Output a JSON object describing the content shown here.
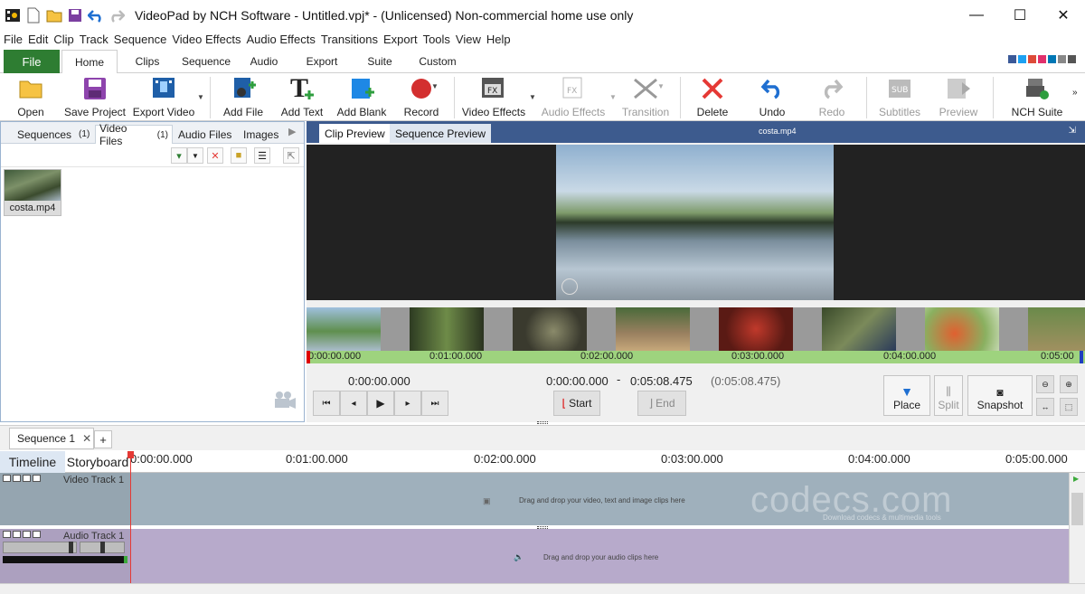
{
  "window": {
    "title": "VideoPad by NCH Software - Untitled.vpj* - (Unlicensed) Non-commercial home use only",
    "minimize": "—",
    "maximize": "☐",
    "close": "✕"
  },
  "menu": [
    "File",
    "Edit",
    "Clip",
    "Track",
    "Sequence",
    "Video Effects",
    "Audio Effects",
    "Transitions",
    "Export",
    "Tools",
    "View",
    "Help"
  ],
  "ribbon_tabs": {
    "file": "File",
    "tabs": [
      "Home",
      "Clips",
      "Sequence",
      "Audio",
      "Export",
      "Suite",
      "Custom"
    ],
    "active": "Home"
  },
  "ribbon": {
    "open": "Open",
    "save_project": "Save Project",
    "export_video": "Export Video",
    "add_file": "Add File",
    "add_text": "Add Text",
    "add_blank": "Add Blank",
    "record": "Record",
    "video_effects": "Video Effects",
    "audio_effects": "Audio Effects",
    "transition": "Transition",
    "delete": "Delete",
    "undo": "Undo",
    "redo": "Redo",
    "subtitles": "Subtitles",
    "preview": "Preview",
    "nch_suite": "NCH Suite",
    "text_glyph": "T",
    "sub_glyph": "SUB",
    "fx_glyph": "FX"
  },
  "left_panel": {
    "tabs": [
      {
        "label": "Sequences",
        "count": "(1)"
      },
      {
        "label": "Video Files",
        "count": "(1)"
      },
      {
        "label": "Audio Files",
        "count": ""
      },
      {
        "label": "Images",
        "count": ""
      }
    ],
    "active_tab": "Video Files",
    "files": [
      {
        "name": "costa.mp4"
      }
    ]
  },
  "preview": {
    "tabs": [
      "Clip Preview",
      "Sequence Preview"
    ],
    "active_tab": "Clip Preview",
    "clip_name": "costa.mp4",
    "ruler_labels": [
      "0:00:00.000",
      "0:01:00.000",
      "0:02:00.000",
      "0:03:00.000",
      "0:04:00.000",
      "0:05:00"
    ],
    "current_time": "0:00:00.000",
    "start_time": "0:00:00.000",
    "separator": "-",
    "end_time": "0:05:08.475",
    "duration": "(0:05:08.475)",
    "start_label": "Start",
    "end_label": "End",
    "place_label": "Place",
    "split_label": "Split",
    "snapshot_label": "Snapshot"
  },
  "sequence": {
    "tab_label": "Sequence 1",
    "close": "✕",
    "add": "+",
    "view_tabs": [
      "Timeline",
      "Storyboard"
    ],
    "active_view": "Timeline",
    "ruler_labels": [
      "0:00:00.000",
      "0:01:00.000",
      "0:02:00.000",
      "0:03:00.000",
      "0:04:00.000",
      "0:05:00.000"
    ],
    "video_track": {
      "name": "Video Track 1",
      "hint": "Drag and drop your video, text and image clips here"
    },
    "audio_track": {
      "name": "Audio Track 1",
      "hint": "Drag and drop your audio clips here"
    }
  },
  "watermark": {
    "main": "codecs.com",
    "sub": "Download codecs & multimedia tools"
  },
  "colors": {
    "file_tab": "#2e7d32",
    "preview_header": "#3d5b8e",
    "ruler_green": "#9ed37e",
    "video_track": "#9fb0bc",
    "audio_track": "#b7aacb",
    "playhead": "#e53935"
  }
}
